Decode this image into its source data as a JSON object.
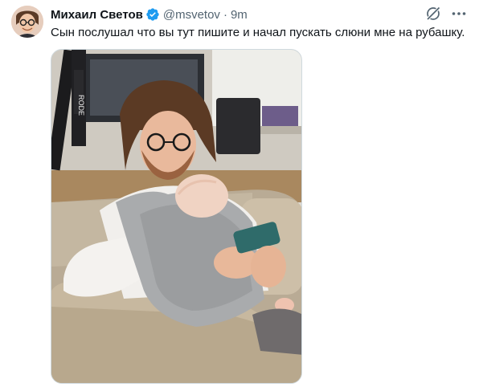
{
  "tweet": {
    "author_name": "Михаил Светов",
    "handle": "@msvetov",
    "separator": "·",
    "time": "9m",
    "text": "Сын послушал что вы тут пишите и начал пускать слюни мне на рубашку.",
    "verified_color": "#1d9bf0",
    "photo_sign_text": "RODE"
  },
  "icons": {
    "verified": "verified-badge-icon",
    "grok": "grok-icon",
    "more": "more-icon"
  }
}
